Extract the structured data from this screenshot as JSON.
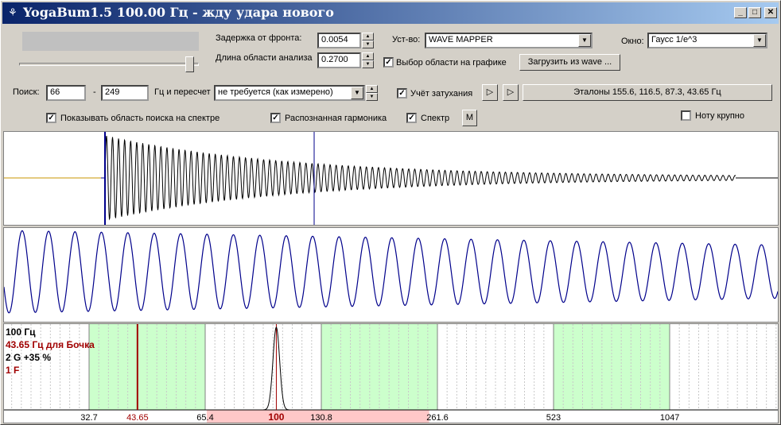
{
  "window": {
    "title": "YogaBum1.5 100.00 Гц - жду удара нового",
    "min_glyph": "_",
    "max_glyph": "□",
    "close_glyph": "✕"
  },
  "controls": {
    "delay_label": "Задержка от фронта:",
    "delay_value": "0.0054",
    "length_label": "Длина области анализа",
    "length_value": "0.2700",
    "device_label": "Уст-во:",
    "device_value": "WAVE MAPPER",
    "window_label": "Окно:",
    "window_value": "Гаусс 1/e^3",
    "select_on_graph_label": "Выбор области на графике",
    "load_wave_label": "Загрузить из wave  ...",
    "search_label": "Поиск:",
    "search_from": "66",
    "search_dash": "-",
    "search_to": "249",
    "recalc_label": "Гц и пересчет",
    "recalc_value": "не требуется (как измерено)",
    "decay_label": "Учёт затухания",
    "play1_glyph": "▷",
    "play2_glyph": "▷",
    "references_label": "Эталоны 155.6, 116.5, 87.3, 43.65 Гц",
    "show_search_area_label": "Показывать область поиска на спектре",
    "recognized_harmonic_label": "Распознанная гармоника",
    "spectrum_label": "Спектр",
    "m_button_label": "M",
    "big_note_label": "Ноту крупно",
    "check_glyph": "✓",
    "slider_position": 0.97
  },
  "spectrum": {
    "info_freq": "100 Гц",
    "info_ref": "43.65 Гц для Бочка",
    "info_note": "2 G  +35 %",
    "info_note2": "1 F",
    "axis_labels": [
      "32.7",
      "43.65",
      "65.4",
      "100",
      "130.8",
      "261.6",
      "523",
      "1047"
    ],
    "ref_freq": 43.65,
    "peak_freq": 100,
    "search_range": [
      66,
      249
    ]
  },
  "colors": {
    "title_start": "#0a246a",
    "title_end": "#a6caf0",
    "wave_black": "#000000",
    "wave_blue": "#00008b",
    "marker_red": "#a00000",
    "search_pink": "#ffc8c8",
    "octave_green": "#ccffcc",
    "gray_line": "#a0a0a0",
    "baseline_orange": "#c89600"
  }
}
